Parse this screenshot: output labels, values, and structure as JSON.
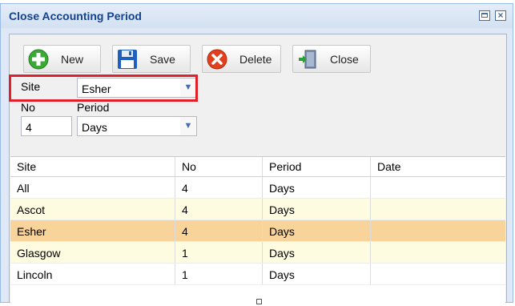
{
  "window": {
    "title": "Close Accounting Period"
  },
  "toolbar": {
    "new_label": "New",
    "save_label": "Save",
    "delete_label": "Delete",
    "close_label": "Close"
  },
  "form": {
    "site_label": "Site",
    "site_value": "Esher",
    "no_label": "No",
    "no_value": "4",
    "period_label": "Period",
    "period_value": "Days"
  },
  "grid": {
    "columns": [
      "Site",
      "No",
      "Period",
      "Date"
    ],
    "rows": [
      [
        "All",
        "4",
        "Days",
        ""
      ],
      [
        "Ascot",
        "4",
        "Days",
        ""
      ],
      [
        "Esher",
        "4",
        "Days",
        ""
      ],
      [
        "Glasgow",
        "1",
        "Days",
        ""
      ],
      [
        "Lincoln",
        "1",
        "Days",
        ""
      ]
    ]
  },
  "colors": {
    "highlight": "#e0202a",
    "selected_row": "#f8d39a",
    "alt_row": "#fefce0",
    "title": "#15428b"
  }
}
